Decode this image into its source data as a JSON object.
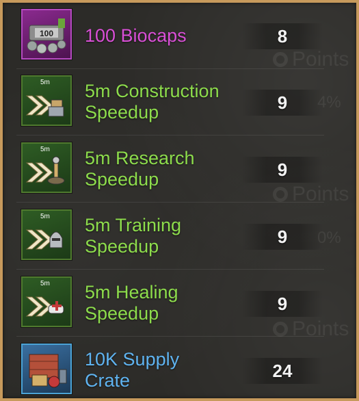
{
  "items": [
    {
      "label": "100 Biocaps",
      "quantity": "8",
      "color": "#d94fd6",
      "icon": "biocaps-icon",
      "badge": "100"
    },
    {
      "label": "5m Construction Speedup",
      "line1": "5m Construction",
      "line2": "Speedup",
      "quantity": "9",
      "color": "#8ddc4c",
      "icon": "construction-speedup-icon",
      "badge": "5m"
    },
    {
      "label": "5m Research Speedup",
      "line1": "5m Research",
      "line2": "Speedup",
      "quantity": "9",
      "color": "#8ddc4c",
      "icon": "research-speedup-icon",
      "badge": "5m"
    },
    {
      "label": "5m Training Speedup",
      "line1": "5m Training",
      "line2": "Speedup",
      "quantity": "9",
      "color": "#8ddc4c",
      "icon": "training-speedup-icon",
      "badge": "5m"
    },
    {
      "label": "5m Healing Speedup",
      "line1": "5m Healing",
      "line2": "Speedup",
      "quantity": "9",
      "color": "#8ddc4c",
      "icon": "healing-speedup-icon",
      "badge": "5m"
    },
    {
      "label": "10K Supply Crate",
      "line1": "10K Supply",
      "line2": "Crate",
      "quantity": "24",
      "color": "#5fb3f0",
      "icon": "supply-crate-icon"
    }
  ],
  "background": {
    "points_label": "Points",
    "percent_1": "4%",
    "percent_2": "0%"
  }
}
